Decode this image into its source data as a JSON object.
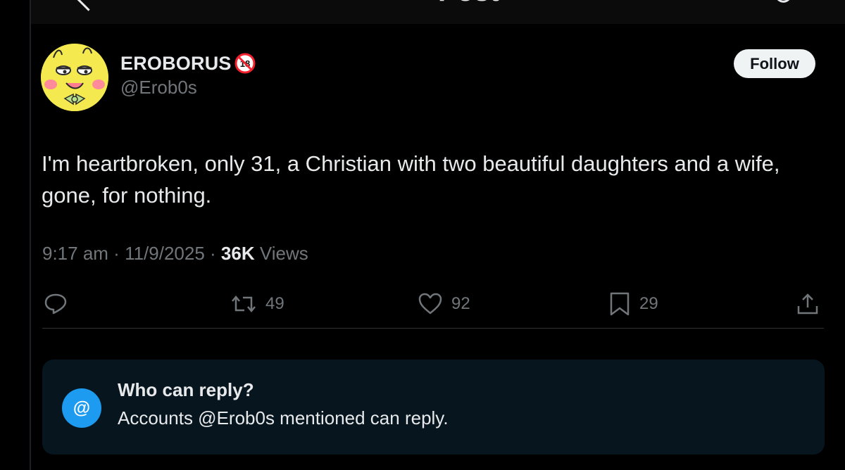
{
  "header": {
    "title_fragment": "Post"
  },
  "author": {
    "display_name": "EROBORUS",
    "badge": "18",
    "handle": "@Erob0s",
    "avatar_icon": "yellow-cartoon-avatar"
  },
  "follow_button": {
    "label": "Follow"
  },
  "post": {
    "text": "I'm heartbroken, only 31, a Christian with two beautiful daughters and a wife, gone, for nothing.",
    "time": "9:17 am",
    "sep1": " · ",
    "date": "11/9/2025",
    "sep2": " · ",
    "views_count": "36K",
    "views_label": " Views"
  },
  "actions": {
    "reply": {
      "icon": "reply-icon",
      "count": ""
    },
    "repost": {
      "icon": "repost-icon",
      "count": "49"
    },
    "like": {
      "icon": "heart-icon",
      "count": "92"
    },
    "bookmark": {
      "icon": "bookmark-icon",
      "count": "29"
    },
    "share": {
      "icon": "share-icon",
      "count": ""
    }
  },
  "reply_settings": {
    "icon_glyph": "@",
    "title": "Who can reply?",
    "description": "Accounts @Erob0s mentioned can reply."
  },
  "colors": {
    "background": "#000000",
    "text_primary": "#e7e9ea",
    "text_secondary": "#71767b",
    "accent_blue": "#1d9bf0",
    "card_background": "#07151f",
    "badge_red": "#f4212e"
  }
}
